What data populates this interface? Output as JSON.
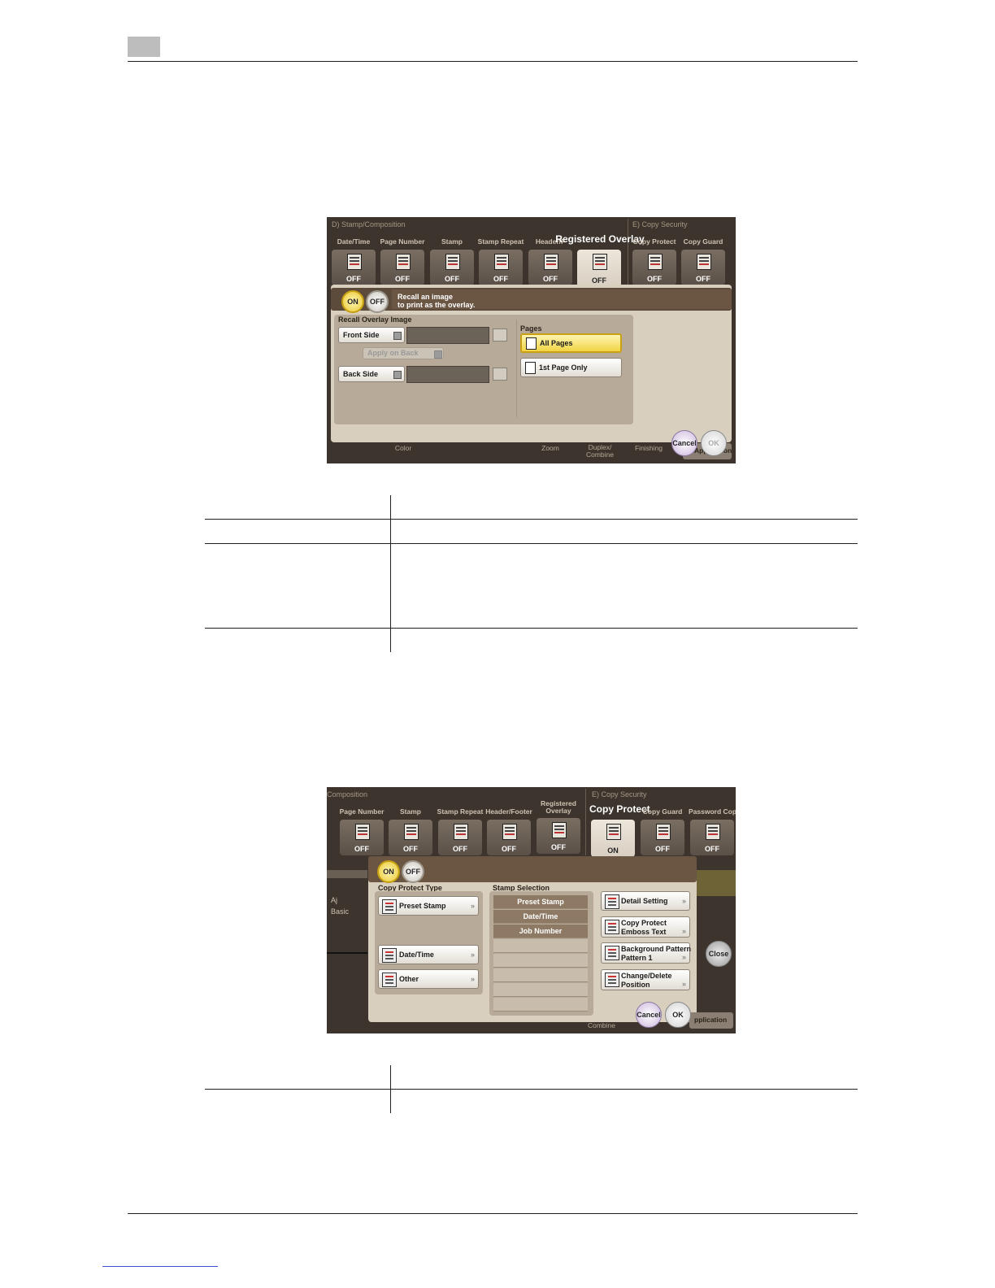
{
  "screen1": {
    "group_left": "D)  Stamp/Composition",
    "group_right": "E)  Copy Security",
    "functions": [
      {
        "name": "Date/Time",
        "state": "OFF"
      },
      {
        "name": "Page Number",
        "state": "OFF"
      },
      {
        "name": "Stamp",
        "state": "OFF"
      },
      {
        "name": "Stamp Repeat",
        "state": "OFF"
      },
      {
        "name": "Header/F",
        "state": "OFF"
      },
      {
        "name": "Registered Overlay",
        "state": "OFF"
      },
      {
        "name": "Copy Protect",
        "state": "OFF"
      },
      {
        "name": "Copy Guard",
        "state": "OFF"
      }
    ],
    "on_label": "ON",
    "off_label": "OFF",
    "message": "Recall an image\nto print as the overlay.",
    "recall_label": "Recall Overlay Image",
    "front_side": "Front Side",
    "apply_on_back": "Apply on Back",
    "back_side": "Back Side",
    "pages_label": "Pages",
    "all_pages": "All Pages",
    "first_page_only": "1st Page Only",
    "cancel": "Cancel",
    "ok": "OK",
    "bottom_tabs": [
      "Color",
      "Zoom",
      "Duplex/\nCombine",
      "Finishing",
      "Application"
    ]
  },
  "screen2": {
    "group_left": "Composition",
    "group_right": "E)  Copy Security",
    "functions": [
      {
        "name": "Page Number",
        "state": "OFF"
      },
      {
        "name": "Stamp",
        "state": "OFF"
      },
      {
        "name": "Stamp Repeat",
        "state": "OFF"
      },
      {
        "name": "Header/Footer",
        "state": "OFF"
      },
      {
        "name": "Registered\nOverlay",
        "state": "OFF"
      },
      {
        "name": "Copy Protect",
        "state": "ON"
      },
      {
        "name": "Copy Guard",
        "state": "OFF"
      },
      {
        "name": "Password Copy",
        "state": "OFF"
      }
    ],
    "on_label": "ON",
    "off_label": "OFF",
    "type_label": "Copy Protect Type",
    "preset_stamp": "Preset Stamp",
    "date_time": "Date/Time",
    "other": "Other",
    "stamp_sel_label": "Stamp Selection",
    "stamps": [
      "Preset Stamp",
      "Date/Time",
      "Job Number"
    ],
    "detail_setting": "Detail Setting",
    "emboss_1": "Copy Protect",
    "emboss_2": "Emboss Text",
    "bg_1": "Background Pattern",
    "bg_2": "Pattern 1",
    "change_1": "Change/Delete",
    "change_2": "Position",
    "left_a": "Aj",
    "left_b": "Basic",
    "close": "Close",
    "cancel": "Cancel",
    "ok": "OK",
    "bottom_left": "Combine",
    "bottom_right": "pplication"
  }
}
